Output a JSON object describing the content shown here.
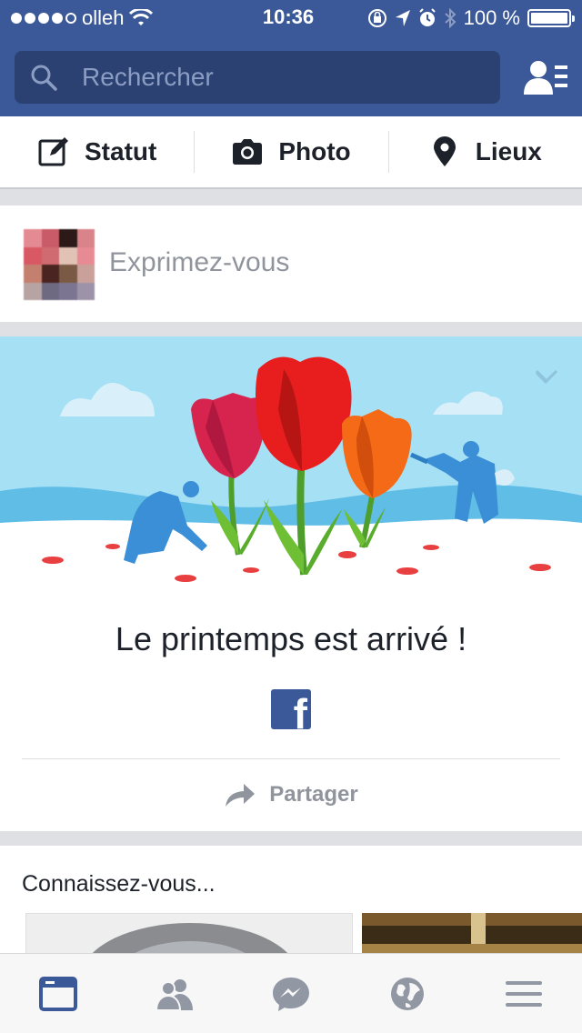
{
  "status_bar": {
    "carrier": "olleh",
    "time": "10:36",
    "battery": "100 %"
  },
  "search": {
    "placeholder": "Rechercher"
  },
  "composer": {
    "items": [
      {
        "label": "Statut",
        "icon": "edit-icon"
      },
      {
        "label": "Photo",
        "icon": "camera-icon"
      },
      {
        "label": "Lieux",
        "icon": "location-pin-icon"
      }
    ]
  },
  "post_box": {
    "prompt": "Exprimez-vous"
  },
  "spring_card": {
    "title": "Le printemps est arrivé !",
    "share_label": "Partager"
  },
  "pymk": {
    "title": "Connaissez-vous..."
  },
  "tab_bar": {
    "tabs": [
      {
        "icon": "news-feed-icon",
        "active": true
      },
      {
        "icon": "friends-icon",
        "active": false
      },
      {
        "icon": "messenger-icon",
        "active": false
      },
      {
        "icon": "globe-icon",
        "active": false
      },
      {
        "icon": "menu-icon",
        "active": false
      }
    ]
  },
  "colors": {
    "brand": "#3b5998",
    "search_bg": "#2b4171",
    "active_tab": "#3b5998",
    "inactive_tab": "#9197a3"
  }
}
